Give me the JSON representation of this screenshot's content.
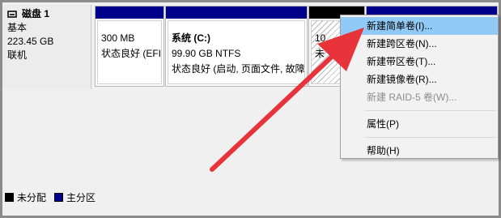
{
  "disk": {
    "name": "磁盘 1",
    "type": "基本",
    "size": "223.45 GB",
    "status": "联机"
  },
  "partitions": [
    {
      "size": "300 MB",
      "status": "状态良好 (EFI"
    },
    {
      "name": "系统 (C:)",
      "size": "99.90 GB NTFS",
      "status": "状态良好 (启动, 页面文件, 故障"
    },
    {
      "size": "10",
      "status": "未"
    }
  ],
  "legend": {
    "unallocated": "未分配",
    "primary": "主分区"
  },
  "context_menu": {
    "new_simple": "新建简单卷(I)...",
    "new_spanned": "新建跨区卷(N)...",
    "new_striped": "新建带区卷(T)...",
    "new_mirrored": "新建镜像卷(R)...",
    "new_raid5": "新建 RAID-5 卷(W)...",
    "properties": "属性(P)",
    "help": "帮助(H)"
  },
  "colors": {
    "primary_partition": "#00008b",
    "unallocated": "#000000",
    "menu_highlight": "#91c9f7",
    "arrow": "#e8333a"
  }
}
